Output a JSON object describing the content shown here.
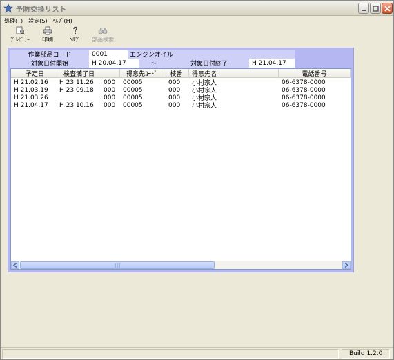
{
  "window": {
    "title": "予防交換リスト",
    "icon": "app-icon",
    "controls": [
      "minimize-icon",
      "maximize-icon",
      "close-icon"
    ]
  },
  "menu": [
    "処理(T)",
    "設定(S)",
    "ﾍﾙﾌﾟ(H)"
  ],
  "toolbar": {
    "preview": "ﾌﾟﾚﾋﾞｭｰ",
    "print": "印刷",
    "help": "ﾍﾙﾌﾟ",
    "part_search": "部品検索"
  },
  "form": {
    "part_code_label": "作業部品コード",
    "part_code_value": "0001",
    "part_name": "エンジンオイル",
    "date_start_label": "対象日付開始",
    "date_start_value": "H 20.04.17",
    "tilde": "～",
    "date_end_label": "対象日付終了",
    "date_end_value": "H 21.04.17"
  },
  "table": {
    "headers": [
      "予定日",
      "検査満了日",
      "",
      "得意先ｺｰﾄﾞ",
      "枝番",
      "得意先名",
      "電話番号"
    ],
    "rows": [
      [
        "H 21.02.16",
        "H 23.11.26",
        "000",
        "00005",
        "000",
        "小村宗人",
        "06-6378-0000"
      ],
      [
        "H 21.03.19",
        "H 23.09.18",
        "000",
        "00005",
        "000",
        "小村宗人",
        "06-6378-0000"
      ],
      [
        "H 21.03.26",
        "",
        "000",
        "00005",
        "000",
        "小村宗人",
        "06-6378-0000"
      ],
      [
        "H 21.04.17",
        "H 23.10.16",
        "000",
        "00005",
        "000",
        "小村宗人",
        "06-6378-0000"
      ]
    ]
  },
  "status": {
    "build": "Build 1.2.0"
  },
  "colors": {
    "panel": "#b5b7f2",
    "label_bg": "#cfd0f8",
    "chrome": "#ece9d8"
  }
}
